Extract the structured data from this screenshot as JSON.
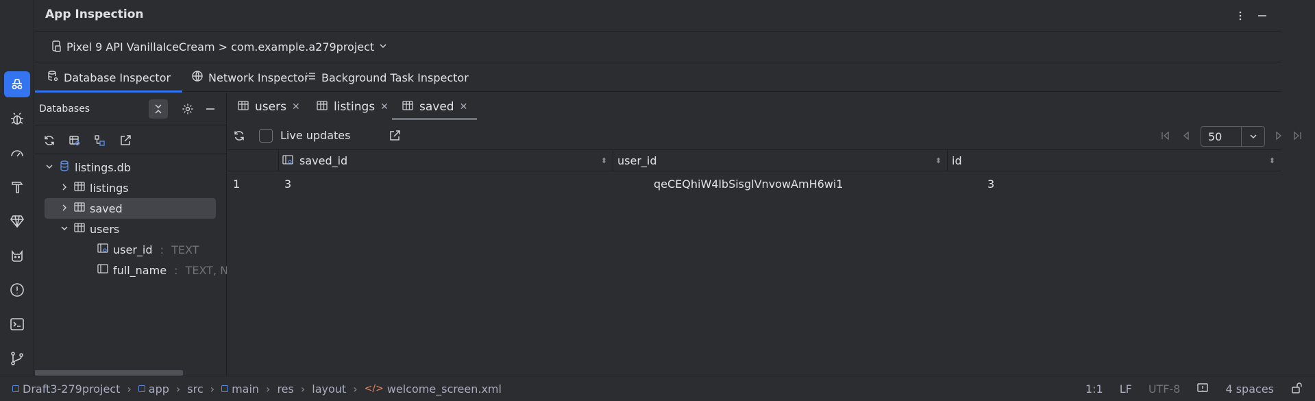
{
  "panel": {
    "title": "App Inspection"
  },
  "device": {
    "label": "Pixel 9 API VanillaIceCream > com.example.a279project"
  },
  "inspector_tabs": [
    "Database Inspector",
    "Network Inspector",
    "Background Task Inspector"
  ],
  "databases": {
    "title": "Databases",
    "tree": {
      "db_name": "listings.db",
      "tables": [
        "listings",
        "saved",
        "users"
      ],
      "columns": [
        {
          "name": "user_id",
          "type": "TEXT"
        },
        {
          "name": "full_name",
          "type": "TEXT, NC"
        }
      ]
    }
  },
  "table_tabs": [
    "users",
    "listings",
    "saved"
  ],
  "toolbar": {
    "live_updates": "Live updates",
    "page_size": "50"
  },
  "grid": {
    "columns": [
      "saved_id",
      "user_id",
      "id"
    ],
    "rows": [
      {
        "index": "1",
        "saved_id": "3",
        "user_id": "qeCEQhiW4lbSisglVnvowAmH6wi1",
        "id": "3"
      }
    ]
  },
  "statusbar": {
    "crumbs": [
      "Draft3-279project",
      "app",
      "src",
      "main",
      "res",
      "layout",
      "welcome_screen.xml"
    ],
    "position": "1:1",
    "line_sep": "LF",
    "encoding": "UTF-8",
    "indent": "4 spaces"
  },
  "colors": {
    "accent": "#3574f0",
    "background": "#2b2d30",
    "xml_icon": "#e8875b"
  }
}
